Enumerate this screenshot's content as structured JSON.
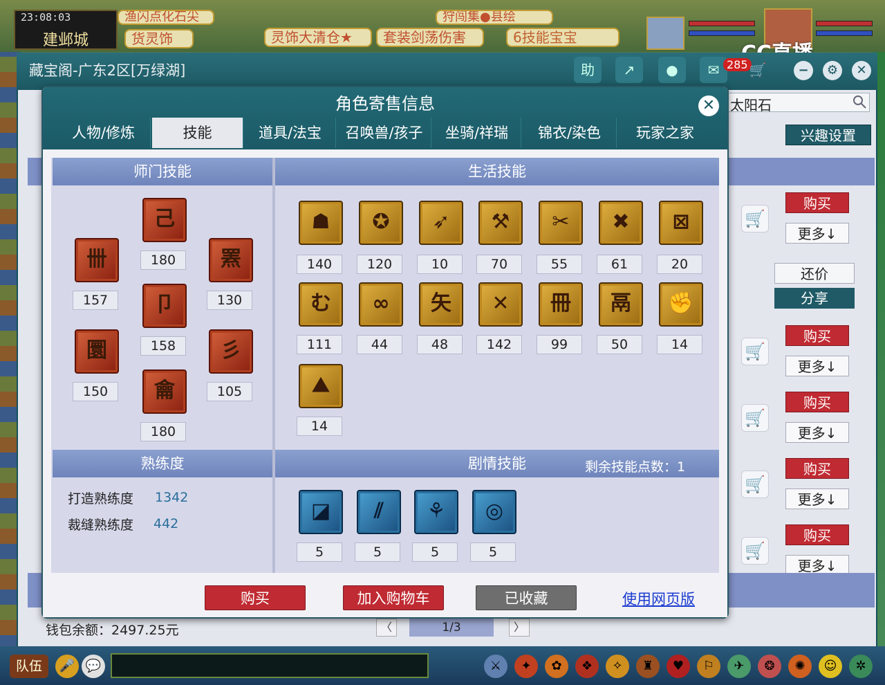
{
  "hud": {
    "clock": "23:08:03",
    "city": "建邺城",
    "tags": [
      "渔闪点化石尖",
      "货灵饰",
      "灵饰大清仓★",
      "套装剑荡伤害",
      "6技能宝宝",
      "狩闯集●县绘"
    ],
    "live_logo": "CC直播"
  },
  "window": {
    "title": "藏宝阁-广东2区[万绿湖]",
    "help_label": "助",
    "message_count": "285",
    "search_value": "太阳石",
    "interest_label": "兴趣设置",
    "bargain_label": "还价",
    "share_label": "分享",
    "buy_label": "购买",
    "more_label": "更多↓",
    "wallet": "钱包余额：2497.25元",
    "pager": "1/3",
    "pager_prev": "〈",
    "pager_next": "〉"
  },
  "bottom_bar": {
    "team_label": "队伍"
  },
  "dialog": {
    "title": "角色寄售信息",
    "close_icon": "close-icon",
    "tabs": [
      "人物/修炼",
      "技能",
      "道具/法宝",
      "召唤兽/孩子",
      "坐骑/祥瑞",
      "锦衣/染色",
      "玩家之家"
    ],
    "active_tab": "技能",
    "sections": {
      "school": "师门技能",
      "life": "生活技能",
      "proficiency": "熟练度",
      "story": "剧情技能"
    },
    "school_skills": [
      "157",
      "180",
      "130",
      "158",
      "150",
      "180",
      "105"
    ],
    "life_skills": [
      "140",
      "120",
      "10",
      "70",
      "55",
      "61",
      "20",
      "111",
      "44",
      "48",
      "142",
      "99",
      "50",
      "14",
      "14"
    ],
    "story_skills": [
      "5",
      "5",
      "5",
      "5"
    ],
    "remaining_points": "剩余技能点数：1",
    "proficiency": {
      "forge_label": "打造熟练度",
      "forge_value": "1342",
      "tailor_label": "裁缝熟练度",
      "tailor_value": "442"
    },
    "buttons": {
      "buy": "购买",
      "add_cart": "加入购物车",
      "favorited": "已收藏",
      "web": "使用网页版"
    }
  }
}
